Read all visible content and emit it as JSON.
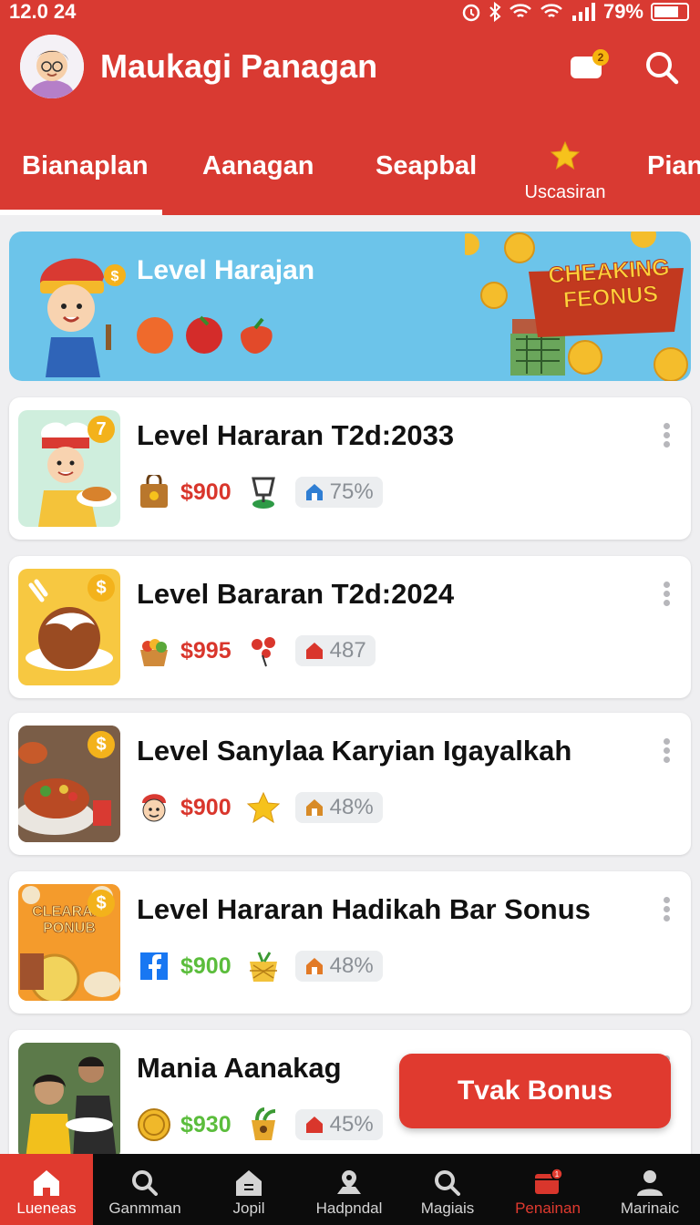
{
  "status": {
    "time": "12.0 24",
    "battery": "79%"
  },
  "app": {
    "title": "Maukagi Panagan",
    "chat_badge": "2"
  },
  "tabs": [
    {
      "label": "Bianaplan",
      "active": true
    },
    {
      "label": "Aanagan"
    },
    {
      "label": "Seapbal"
    },
    {
      "label": "Uscasiran",
      "icon": "star-icon"
    },
    {
      "label": "Pian"
    }
  ],
  "banner": {
    "title": "Level Harajan",
    "sign": "CHEAKING FEONUS"
  },
  "items": [
    {
      "title": "Level Hararan T2d:2033",
      "badge": "7",
      "price": "$900",
      "price_color": "#d9362c",
      "pct": "75%",
      "chip_color": "#2f7ed3"
    },
    {
      "title": "Level Bararan T2d:2024",
      "badge": "$",
      "price": "$995",
      "price_color": "#d9362c",
      "pct": "487",
      "chip_color": "#d9362c"
    },
    {
      "title": "Level Sanylaa Karyian Igayalkah",
      "badge": "$",
      "price": "$900",
      "price_color": "#d9362c",
      "pct": "48%",
      "chip_color": "#d88b27"
    },
    {
      "title": "Level Hararan Hadikah Bar Sonus",
      "badge": "$",
      "thumb_text": "CLEARAIS PONUB",
      "price": "$900",
      "price_color": "#5bbd3c",
      "pct": "48%",
      "chip_color": "#e27a26"
    },
    {
      "title": "Mania Aanakag",
      "price": "$930",
      "price_color": "#5bbd3c",
      "pct": "45%",
      "chip_color": "#d9362c"
    }
  ],
  "fab": {
    "label": "Tvak Bonus"
  },
  "nav": [
    {
      "label": "Lueneas",
      "active": true
    },
    {
      "label": "Ganmman"
    },
    {
      "label": "Jopil"
    },
    {
      "label": "Hadpndal"
    },
    {
      "label": "Magiais"
    },
    {
      "label": "Penainan",
      "badge": "1"
    },
    {
      "label": "Marinaic"
    }
  ]
}
